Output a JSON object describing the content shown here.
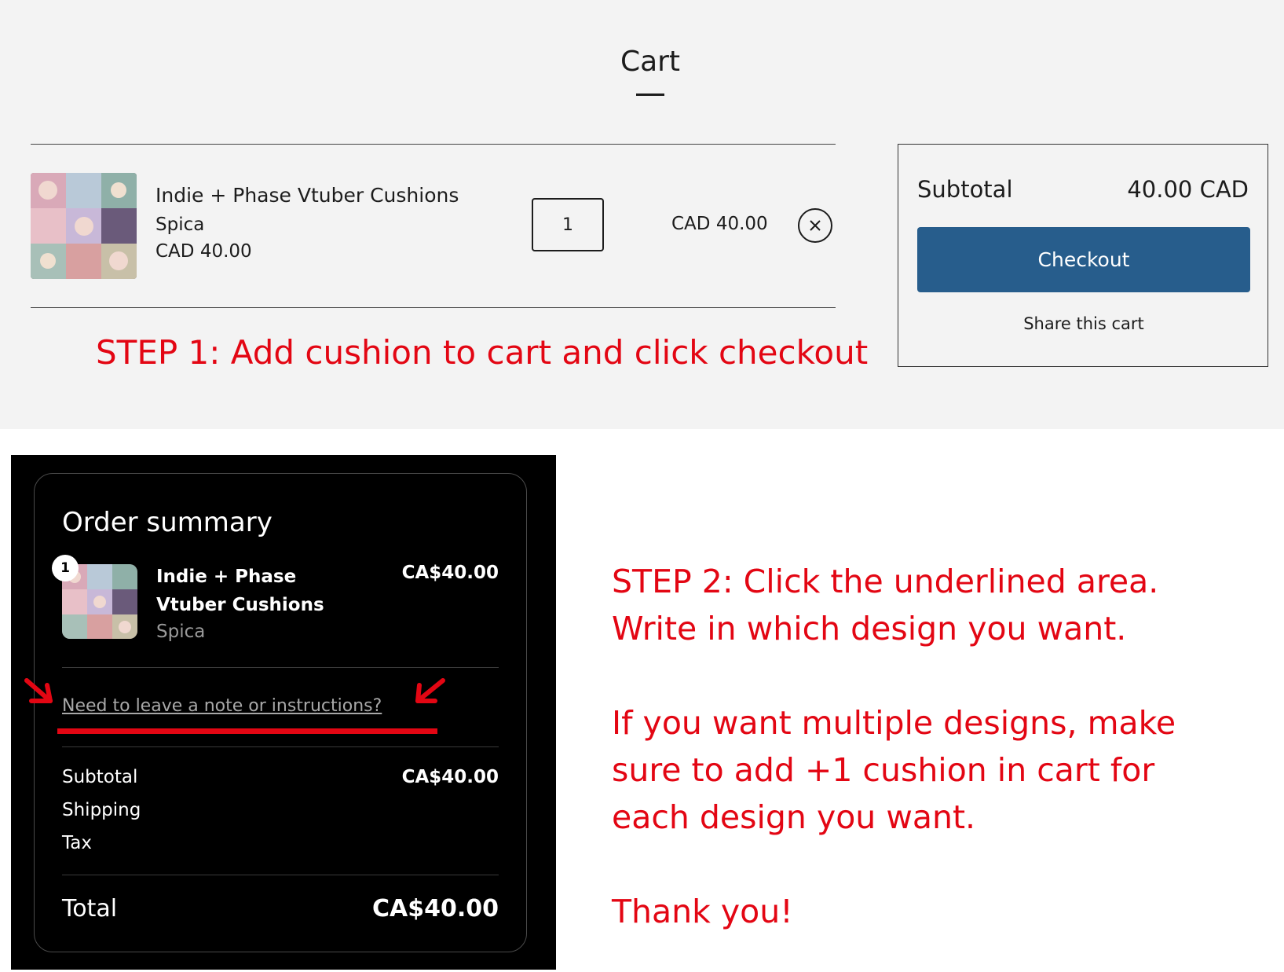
{
  "cart": {
    "title": "Cart",
    "item": {
      "name": "Indie + Phase Vtuber Cushions",
      "vendor": "Spica",
      "price": "CAD 40.00",
      "quantity": "1",
      "line_total": "CAD 40.00"
    },
    "summary": {
      "subtotal_label": "Subtotal",
      "subtotal_value": "40.00 CAD",
      "checkout_label": "Checkout",
      "share_label": "Share this cart"
    }
  },
  "annotations": {
    "step1": "STEP 1: Add cushion to cart and click checkout",
    "step2_lines": [
      "STEP 2: Click the underlined area.",
      "Write in which design you want.",
      "If you want multiple designs, make",
      "sure to add +1 cushion in cart for",
      "each design you want.",
      "Thank you!"
    ]
  },
  "order_summary": {
    "title": "Order summary",
    "item": {
      "quantity_badge": "1",
      "name": "Indie + Phase Vtuber Cushions",
      "vendor": "Spica",
      "price": "CA$40.00"
    },
    "note_link": "Need to leave a note or instructions?",
    "subtotal_label": "Subtotal",
    "subtotal_value": "CA$40.00",
    "shipping_label": "Shipping",
    "tax_label": "Tax",
    "total_label": "Total",
    "total_value": "CA$40.00"
  },
  "colors": {
    "checkout_button": "#275d8c",
    "annotation_red": "#e30613",
    "cart_background": "#f3f3f3",
    "order_background": "#000000"
  }
}
